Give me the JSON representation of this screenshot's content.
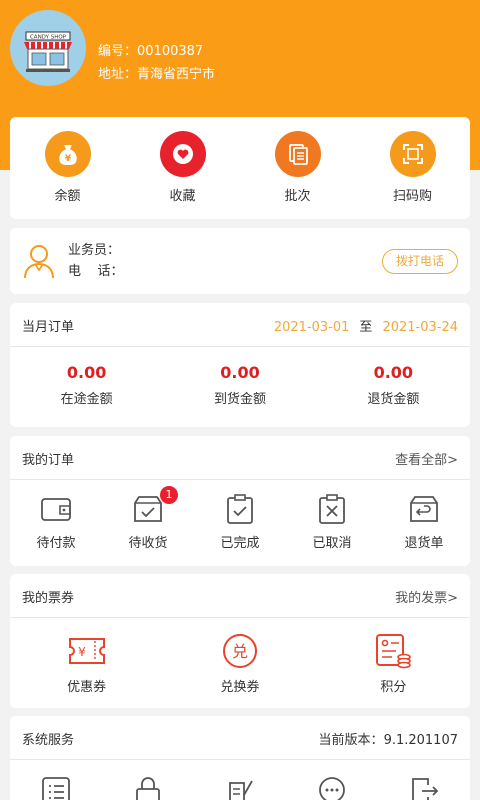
{
  "header": {
    "avatar_text": "CANDY SHOP",
    "code_label": "编号：",
    "code_value": "00100387",
    "address_label": "地址：",
    "address_value": "青海省西宁市"
  },
  "quick_actions": [
    {
      "label": "余额",
      "icon": "money-bag-icon"
    },
    {
      "label": "收藏",
      "icon": "heart-icon"
    },
    {
      "label": "批次",
      "icon": "batch-icon"
    },
    {
      "label": "扫码购",
      "icon": "scan-icon"
    }
  ],
  "quick_colors": {
    "orange": "#f59a1b",
    "red": "#e8222c",
    "deep_orange": "#f07820"
  },
  "salesman": {
    "label": "业务员：",
    "phone_label": "电    话：",
    "call_button": "拨打电话"
  },
  "monthly": {
    "title": "当月订单",
    "start_date": "2021-03-01",
    "to": "至",
    "end_date": "2021-03-24",
    "amounts": [
      {
        "value": "0.00",
        "label": "在途金额"
      },
      {
        "value": "0.00",
        "label": "到货金额"
      },
      {
        "value": "0.00",
        "label": "退货金额"
      }
    ]
  },
  "my_orders": {
    "title": "我的订单",
    "view_all": "查看全部>",
    "items": [
      {
        "label": "待付款",
        "icon": "wallet-icon"
      },
      {
        "label": "待收货",
        "icon": "box-check-icon",
        "badge": "1"
      },
      {
        "label": "已完成",
        "icon": "clipboard-check-icon"
      },
      {
        "label": "已取消",
        "icon": "clipboard-x-icon"
      },
      {
        "label": "退货单",
        "icon": "box-return-icon"
      }
    ]
  },
  "my_coupons": {
    "title": "我的票券",
    "invoice": "我的发票>",
    "items": [
      {
        "label": "优惠券",
        "icon": "coupon-icon",
        "glyph": "¥"
      },
      {
        "label": "兑换券",
        "icon": "exchange-icon",
        "glyph": "兑"
      },
      {
        "label": "积分",
        "icon": "points-icon"
      }
    ]
  },
  "system": {
    "title": "系统服务",
    "version_label": "当前版本：",
    "version": "9.1.201107",
    "items": [
      {
        "icon": "list-icon"
      },
      {
        "icon": "lock-icon"
      },
      {
        "icon": "edit-icon"
      },
      {
        "icon": "message-icon"
      },
      {
        "icon": "logout-icon"
      }
    ]
  }
}
